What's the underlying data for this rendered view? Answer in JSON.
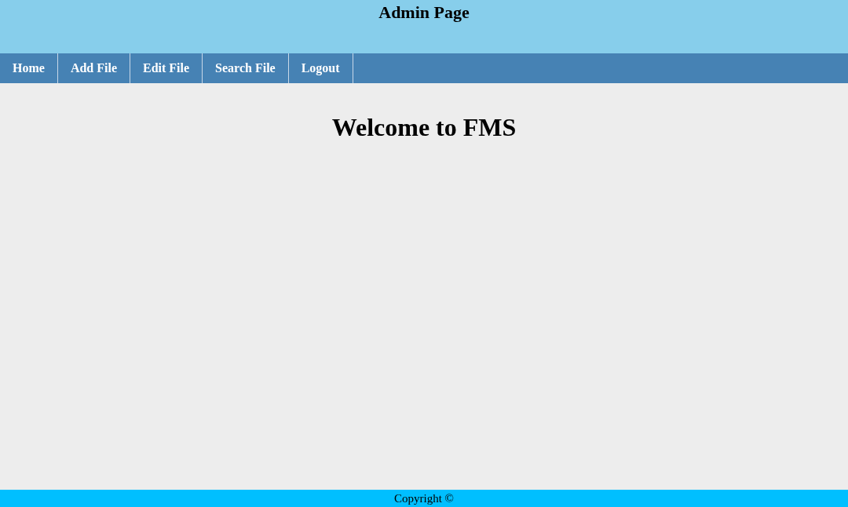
{
  "header": {
    "title": "Admin Page"
  },
  "nav": [
    {
      "label": "Home"
    },
    {
      "label": "Add File"
    },
    {
      "label": "Edit File"
    },
    {
      "label": "Search File"
    },
    {
      "label": "Logout"
    }
  ],
  "main": {
    "heading": "Welcome to FMS"
  },
  "footer": {
    "text": "Copyright ©"
  }
}
